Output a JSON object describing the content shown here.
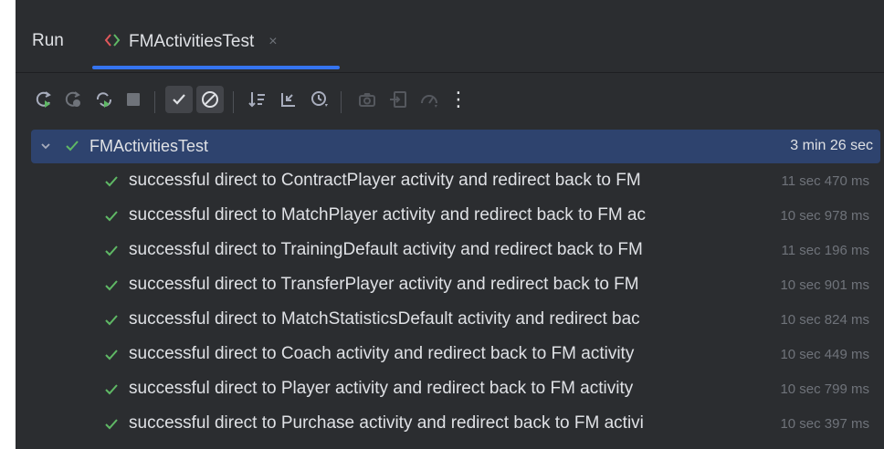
{
  "tabs": {
    "run_label": "Run",
    "test_tab_label": "FMActivitiesTest",
    "close_glyph": "×"
  },
  "toolbar": {
    "icons": [
      "rerun-icon",
      "rerun-failed-icon",
      "rerun-automatic-icon",
      "stop-icon",
      "show-passed-icon",
      "show-ignored-icon",
      "sort-alphabetically-icon",
      "expand-collapse-icon",
      "sort-by-duration-icon",
      "screenshot-icon",
      "import-tests-icon",
      "history-icon",
      "more-options-icon"
    ],
    "more_glyph": "⋮"
  },
  "colors": {
    "panel_bg": "#2b2d30",
    "selection_bg": "#2e436e",
    "accent_blue": "#3574f0",
    "pass_green": "#5fb865",
    "muted_text": "#6f737a"
  },
  "tree": {
    "root": {
      "label": "FMActivitiesTest",
      "duration": "3 min 26 sec"
    },
    "items": [
      {
        "label": "successful direct to ContractPlayer activity and redirect back to FM",
        "duration": "11 sec 470 ms"
      },
      {
        "label": "successful direct to MatchPlayer activity and redirect back to FM ac",
        "duration": "10 sec 978 ms"
      },
      {
        "label": "successful direct to TrainingDefault activity and redirect back to FM",
        "duration": "11 sec 196 ms"
      },
      {
        "label": "successful direct to TransferPlayer activity and redirect back to FM",
        "duration": "10 sec 901 ms"
      },
      {
        "label": "successful direct to MatchStatisticsDefault activity and redirect bac",
        "duration": "10 sec 824 ms"
      },
      {
        "label": "successful direct to Coach activity and redirect back to FM activity",
        "duration": "10 sec 449 ms"
      },
      {
        "label": "successful direct to Player activity and redirect back to FM activity",
        "duration": "10 sec 799 ms"
      },
      {
        "label": "successful direct to Purchase activity and redirect back to FM activi",
        "duration": "10 sec 397 ms"
      }
    ]
  }
}
